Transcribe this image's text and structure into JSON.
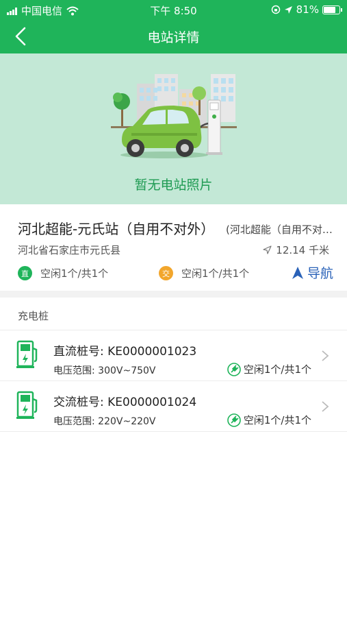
{
  "status_bar": {
    "carrier": "中国电信",
    "time": "下午 8:50",
    "battery_percent": "81%",
    "battery_level": 0.81
  },
  "nav": {
    "title": "电站详情"
  },
  "photo": {
    "placeholder_text": "暂无电站照片"
  },
  "station": {
    "name": "河北超能-元氏站（自用不对外）",
    "alias": "(河北超能（自用不对外）",
    "address": "河北省石家庄市元氏县",
    "distance": "12.14 千米",
    "dc_badge": "直",
    "dc_status": "空闲1个/共1个",
    "ac_badge": "交",
    "ac_status": "空闲1个/共1个",
    "navigate_label": "导航"
  },
  "piles_section": {
    "title": "充电桩",
    "items": [
      {
        "number": "直流桩号: KE0000001023",
        "voltage": "电压范围: 300V~750V",
        "status": "空闲1个/共1个"
      },
      {
        "number": "交流桩号: KE0000001024",
        "voltage": "电压范围: 220V~220V",
        "status": "空闲1个/共1个"
      }
    ]
  },
  "colors": {
    "primary_green": "#1fb45a",
    "photo_background": "#c3e8d6",
    "ac_orange": "#f2a62c",
    "navigate_blue": "#2a62b8"
  },
  "icons": {
    "back": "chevron-left-icon",
    "wifi": "wifi-icon",
    "location": "location-arrow-icon",
    "distance": "navigation-arrow-icon",
    "navigate": "navigate-arrow-icon",
    "pile": "charging-pile-icon",
    "plug": "plug-icon",
    "chevron": "chevron-right-icon"
  }
}
